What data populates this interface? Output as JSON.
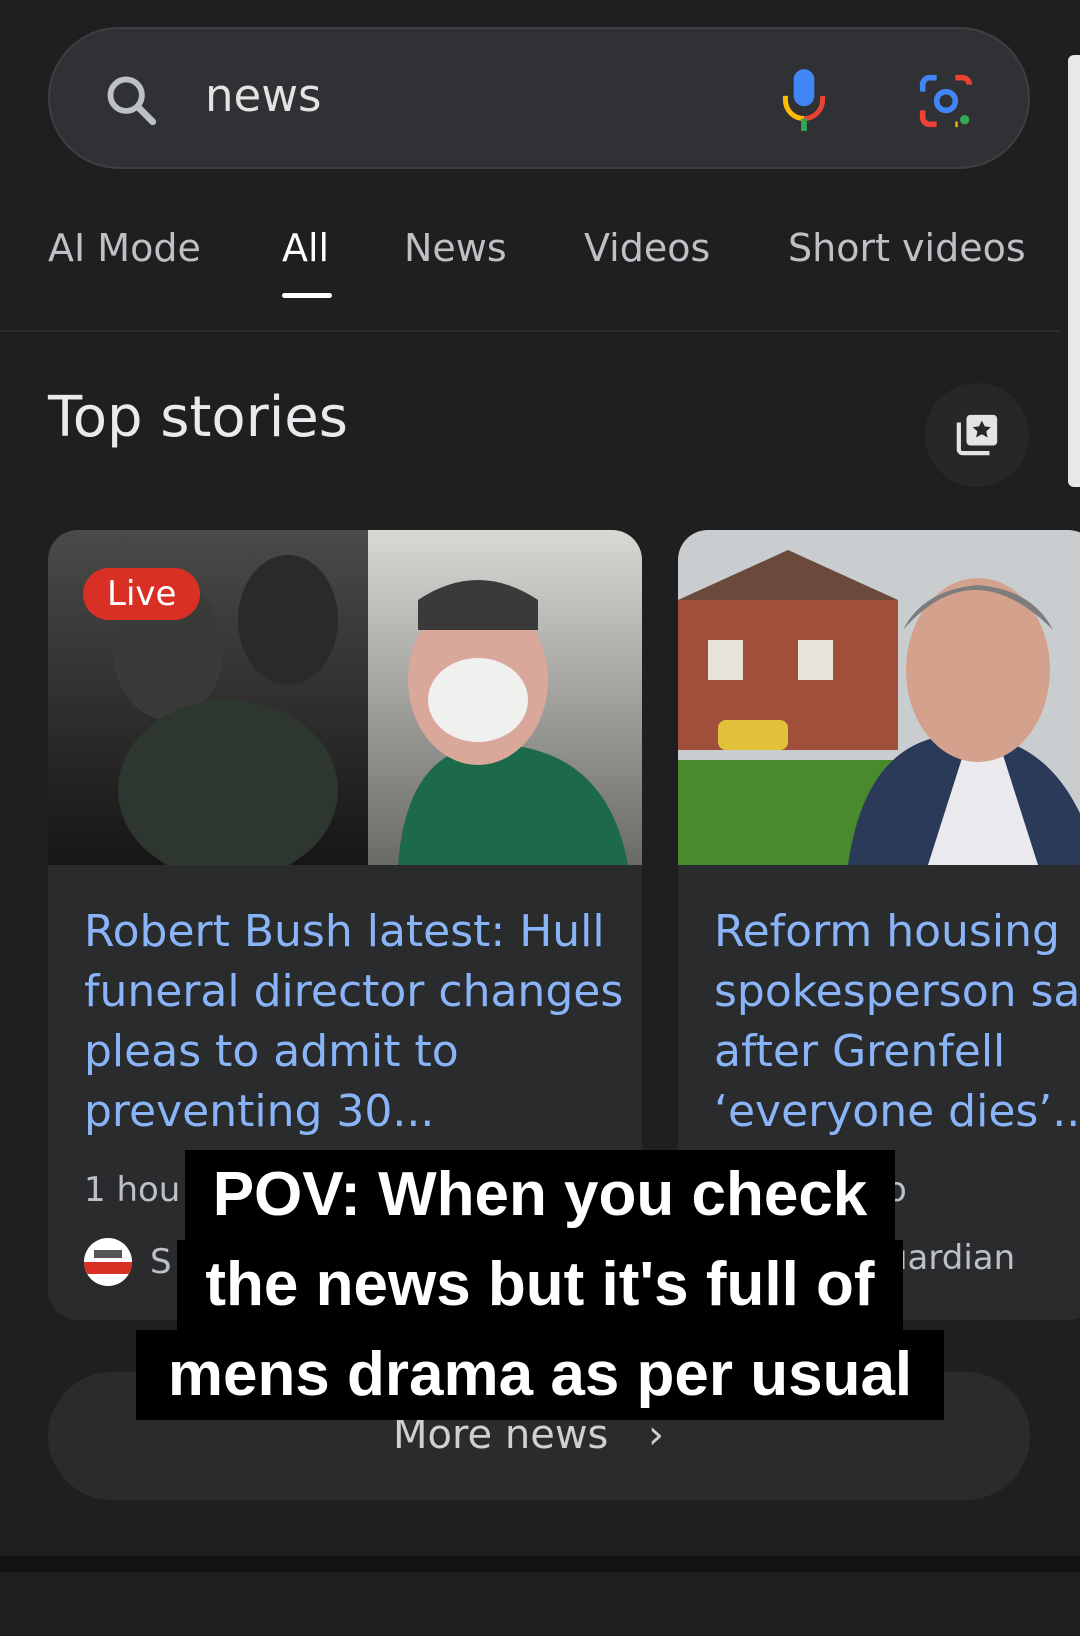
{
  "search": {
    "query": "news"
  },
  "tabs": [
    {
      "label": "AI Mode"
    },
    {
      "label": "All"
    },
    {
      "label": "News"
    },
    {
      "label": "Videos"
    },
    {
      "label": "Short videos"
    }
  ],
  "active_tab": "All",
  "top_stories": {
    "title": "Top stories",
    "cards": [
      {
        "badge": "Live",
        "headline": "Robert Bush latest: Hull funeral director changes pleas to admit to preventing 30...",
        "time": "1 hou",
        "source": "S"
      },
      {
        "headline_lines": [
          "Reform housing",
          "spokesperson sa",
          "after Grenfell",
          "‘everyone dies’..."
        ],
        "time": "o",
        "source": "uardian"
      }
    ]
  },
  "more_news": {
    "label": "More news"
  },
  "overlay_caption": {
    "lines": [
      "POV: When you check",
      "the news but it's full of",
      "mens drama as per usual"
    ]
  },
  "colors": {
    "background": "#1f1f1f",
    "link": "#8ab4f8",
    "live": "#d93025"
  }
}
